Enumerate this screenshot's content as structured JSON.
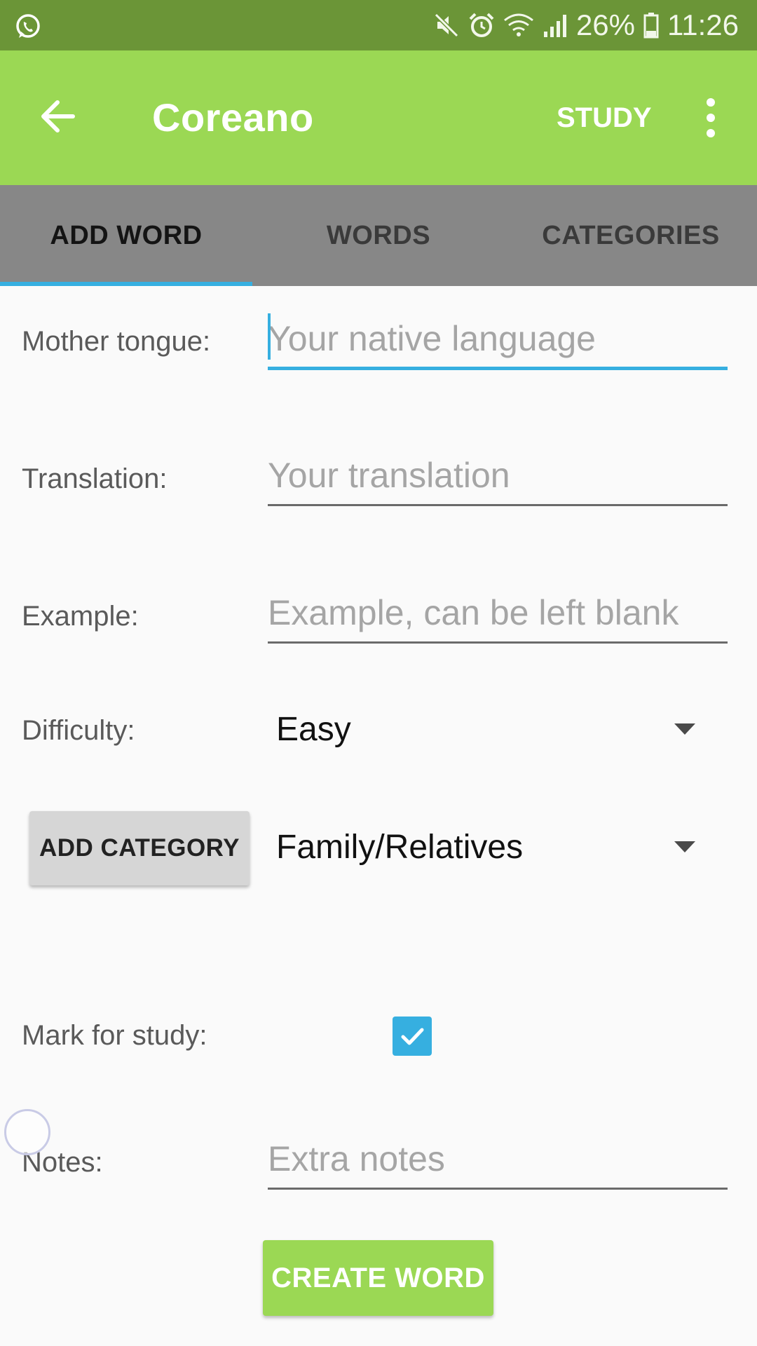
{
  "status_bar": {
    "battery": "26%",
    "time": "11:26",
    "icons": [
      "whatsapp-icon",
      "mute-icon",
      "alarm-icon",
      "wifi-icon",
      "signal-icon",
      "battery-icon"
    ]
  },
  "app_bar": {
    "title": "Coreano",
    "study_label": "STUDY",
    "back_icon": "arrow-left-icon",
    "more_icon": "more-vertical-icon",
    "color": "#9bd854"
  },
  "tabs": [
    {
      "label": "ADD WORD",
      "active": true
    },
    {
      "label": "WORDS",
      "active": false
    },
    {
      "label": "CATEGORIES",
      "active": false
    }
  ],
  "form": {
    "mother_tongue": {
      "label": "Mother tongue:",
      "value": "",
      "placeholder": "Your native language"
    },
    "translation": {
      "label": "Translation:",
      "value": "",
      "placeholder": "Your translation"
    },
    "example": {
      "label": "Example:",
      "value": "",
      "placeholder": "Example, can be left blank"
    },
    "difficulty": {
      "label": "Difficulty:",
      "selected": "Easy"
    },
    "category": {
      "button_label": "ADD CATEGORY",
      "selected": "Family/Relatives"
    },
    "mark_for_study": {
      "label": "Mark for study:",
      "checked": true
    },
    "notes": {
      "label": "Notes:",
      "value": "",
      "placeholder": "Extra notes"
    },
    "create_label": "CREATE WORD"
  },
  "colors": {
    "status_bar": "#6b9537",
    "accent": "#36afe0",
    "tab_bar": "#878787"
  }
}
